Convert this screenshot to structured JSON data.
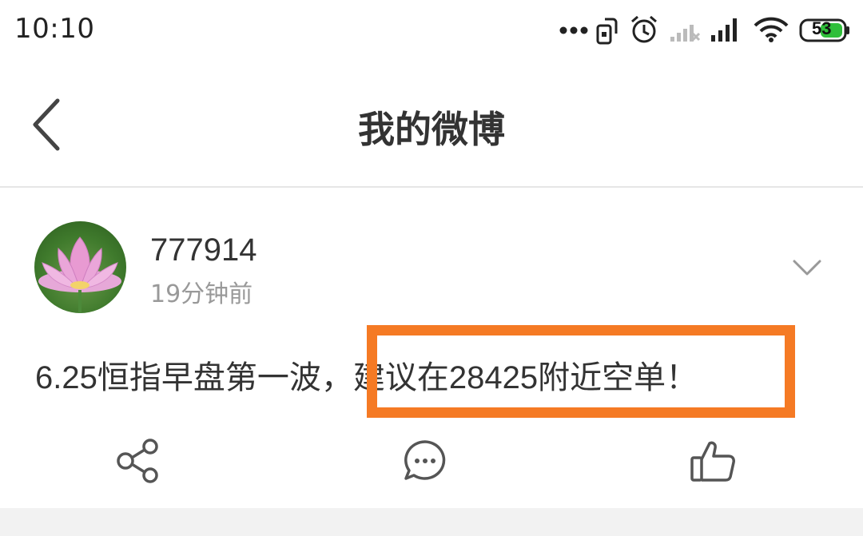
{
  "status_bar": {
    "time": "10:10",
    "battery_level": "53",
    "icons": [
      "more-dots-icon",
      "screen-rotate-icon",
      "alarm-icon",
      "signal-weak-icon",
      "signal-icon",
      "wifi-icon",
      "battery-icon"
    ]
  },
  "navbar": {
    "back_icon": "chevron-left-icon",
    "title": "我的微博"
  },
  "post": {
    "username": "777914",
    "time_ago": "19分钟前",
    "text_before": "6.25恒指早盘第一波，",
    "text_highlight": "建议在28425附近空单！",
    "highlight_color": "#f57a24",
    "actions": [
      "share-icon",
      "comment-icon",
      "like-icon"
    ]
  }
}
